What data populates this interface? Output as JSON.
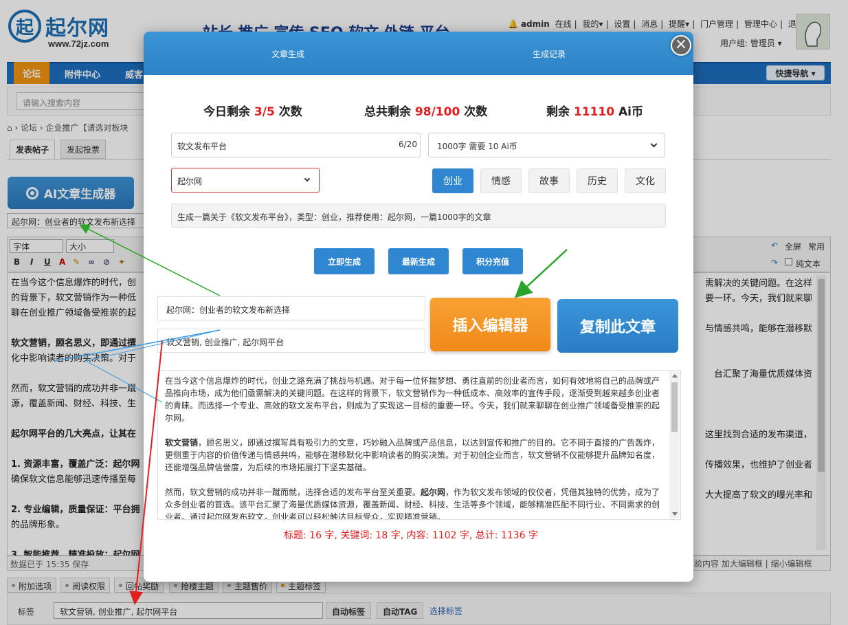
{
  "site": {
    "logo_mark": "起",
    "logo_name": "起尔网",
    "logo_url": "www.72jz.com",
    "slogan": "站长 推广 宣传 SEO 软文 外链 平台"
  },
  "topnav": {
    "user": "admin",
    "online": "在线",
    "items": [
      "我的▾",
      "设置",
      "消息",
      "提醒▾",
      "门户管理",
      "管理中心",
      "退出"
    ],
    "usergroup": "用户组: 管理员 ▾"
  },
  "nav": {
    "items": [
      "论坛",
      "附件中心",
      "威客"
    ],
    "quick": "快捷导航 ▾"
  },
  "search": {
    "placeholder": "请输入搜索内容"
  },
  "breadcrumb": "› 论坛 › 企业推广【请选对板块",
  "tabs": [
    "发表帖子",
    "发起投票"
  ],
  "ai_button": "AI文章生成器",
  "post_title": "起尔网：创业者的软文发布新选择",
  "editor": {
    "font": "字体",
    "size": "大小",
    "fullscreen": "全屏",
    "common": "常用",
    "plaintext": "纯文本",
    "bg_paragraphs": [
      "在当今这个信息爆炸的时代，创",
      "软文营销，顾名思义，即通过撰",
      "然而，软文营销的成功并非一蹴",
      "起尔网平台的几大亮点，让其在",
      "1. 资源丰富，覆盖广泛：起尔网",
      "2. 专业编辑，质量保证：平台拥",
      "3. 智能推荐，精准投放：起尔网"
    ],
    "right_fragments": [
      "需解决的关键问题。在这样",
      "要一环。今天，我们就来聊",
      "与情感共鸣，能够在潜移默",
      "台汇聚了海量优质媒体资",
      "这里找到合适的发布渠道，",
      "传播效果，也维护了创业者",
      "大大提高了软文的曝光率和"
    ],
    "left_lines": [
      "的背景下，软文营销作为一种低",
      "聊在创业推广领域备受推崇的起",
      "化中影响读者的购买决策。对于",
      "源，覆盖新闻、财经、科技、生",
      "确保软文信息能够迅速传播至每",
      "的品牌形象。"
    ],
    "autosave": "数据已于 15:35 保存",
    "footer_right": "验内容   加大编辑框 | 缩小编辑框"
  },
  "options": [
    "附加选项",
    "阅读权限",
    "回帖奖励",
    "抢楼主题",
    "主题售价",
    "主题标签"
  ],
  "tags": {
    "label": "标签",
    "value": "软文营销, 创业推广, 起尔网平台",
    "auto_tag": "自动标签",
    "auto_TAG": "自动TAG",
    "select": "选择标签"
  },
  "modal": {
    "tab_generate": "文章生成",
    "tab_history": "生成记录",
    "close": "×",
    "stats": {
      "today_prefix": "今日剩余 ",
      "today_value": "3/5",
      "today_suffix": " 次数",
      "total_prefix": "总共剩余 ",
      "total_value": "98/100",
      "total_suffix": " 次数",
      "coin_prefix": "剩余 ",
      "coin_value": "11110",
      "coin_suffix": " Ai币"
    },
    "keyword": "软文发布平台",
    "keyword_count": "6/20",
    "length_option": "1000字 需要 10 Ai币",
    "brand": "起尔网",
    "types": [
      "创业",
      "情感",
      "故事",
      "历史",
      "文化"
    ],
    "active_type": "创业",
    "prompt": "生成一篇关于《软文发布平台》，类型：创业，推荐使用：起尔网，一篇1000字的文章",
    "buttons": [
      "立即生成",
      "最新生成",
      "积分充值"
    ],
    "out_title": "起尔网：创业者的软文发布新选择",
    "out_keywords": "软文营销, 创业推广, 起尔网平台",
    "insert": "插入编辑器",
    "copy": "复制此文章",
    "article": {
      "p1": "在当今这个信息爆炸的时代，创业之路充满了挑战与机遇。对于每一位怀揣梦想、勇往直前的创业者而言，如何有效地将自己的品牌或产品推向市场，成为他们亟需解决的关键问题。在这样的背景下，软文营销作为一种低成本、高效率的宣传手段，逐渐受到越来越多创业者的青睐。而选择一个专业、高效的软文发布平台，则成为了实现这一目标的重要一环。今天，我们就来聊聊在创业推广领域备受推崇的起尔网。",
      "p2_bold": "软文营销",
      "p2": "，顾名思义，即通过撰写具有吸引力的文章，巧妙融入品牌或产品信息，以达到宣传和推广的目的。它不同于直接的广告轰炸，更侧重于内容的价值传递与情感共鸣，能够在潜移默化中影响读者的购买决策。对于初创企业而言，软文营销不仅能够提升品牌知名度，还能增强品牌信誉度，为后续的市场拓展打下坚实基础。",
      "p3_a": "然而，软文营销的成功并非一蹴而就，选择合适的发布平台至关重要。",
      "p3_bold": "起尔网",
      "p3_b": "，作为软文发布领域的佼佼者，凭借其独特的优势，成为了众多创业者的首选。该平台汇聚了海量优质媒体资源，覆盖新闻、财经、科技、生活等多个领域，能够精准匹配不同行业、不同需求的创业者。通过起尔网发布软文，创业者可以轻松触达目标受众，实现精准营销。"
    },
    "counter": "标题: 16 字, 关键词: 18 字, 内容: 1102 字, 总计: 1136 字"
  },
  "colors": {
    "accent": "#2f86d1",
    "orange": "#f0891a",
    "red": "#e02020",
    "nav": "#1e6fbf"
  }
}
